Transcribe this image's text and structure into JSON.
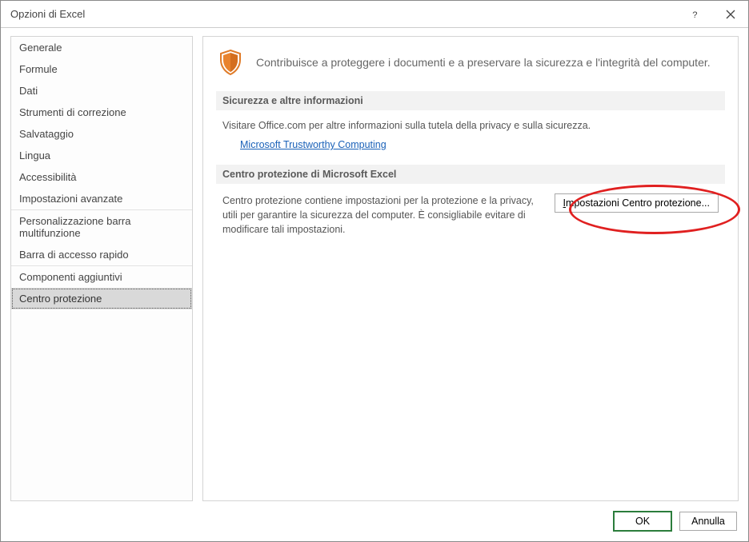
{
  "titlebar": {
    "title": "Opzioni di Excel"
  },
  "sidebar": {
    "items": [
      {
        "label": "Generale"
      },
      {
        "label": "Formule"
      },
      {
        "label": "Dati"
      },
      {
        "label": "Strumenti di correzione"
      },
      {
        "label": "Salvataggio"
      },
      {
        "label": "Lingua"
      },
      {
        "label": "Accessibilità"
      },
      {
        "label": "Impostazioni avanzate"
      },
      {
        "label": "Personalizzazione barra multifunzione"
      },
      {
        "label": "Barra di accesso rapido"
      },
      {
        "label": "Componenti aggiuntivi"
      },
      {
        "label": "Centro protezione"
      }
    ],
    "selected_index": 11
  },
  "main": {
    "header_text": "Contribuisce a proteggere i documenti e a preservare la sicurezza e l'integrità del computer.",
    "section1": {
      "title": "Sicurezza e altre informazioni",
      "text": "Visitare Office.com per altre informazioni sulla tutela della privacy e sulla sicurezza.",
      "link": "Microsoft Trustworthy Computing"
    },
    "section2": {
      "title": "Centro protezione di Microsoft Excel",
      "text": "Centro protezione contiene impostazioni per la protezione e la privacy, utili per garantire la sicurezza del computer. È consigliabile evitare di modificare tali impostazioni.",
      "button": "Impostazioni Centro protezione..."
    }
  },
  "footer": {
    "ok": "OK",
    "cancel": "Annulla"
  }
}
